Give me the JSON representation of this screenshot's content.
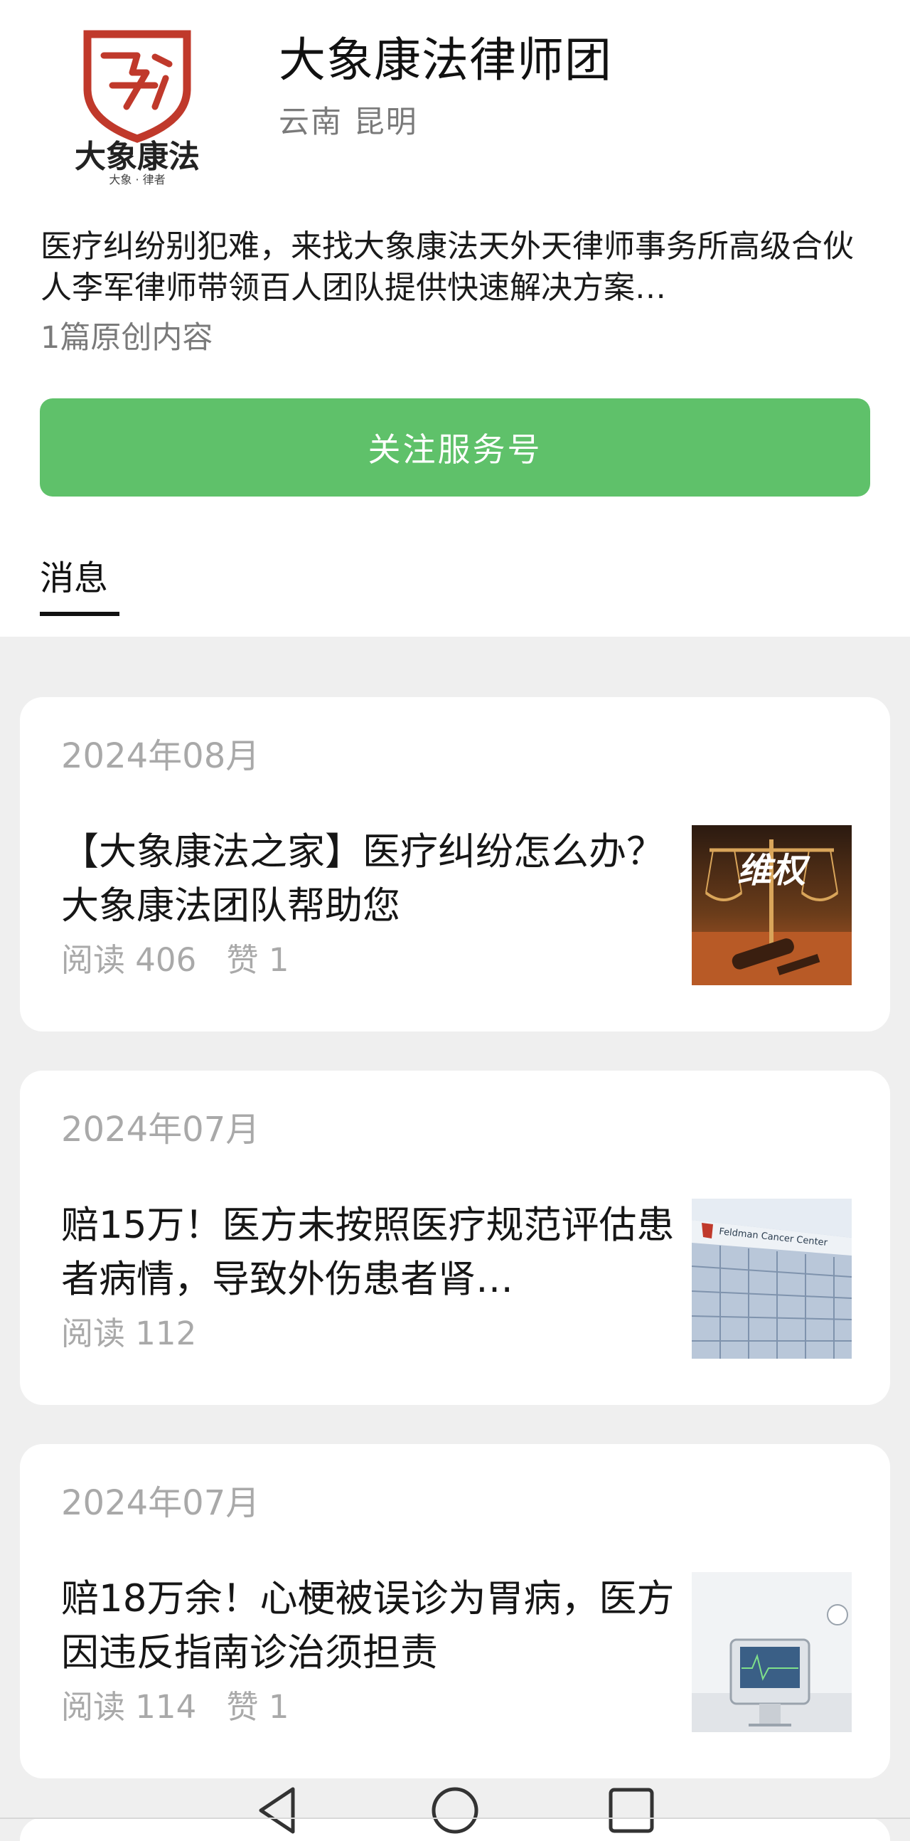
{
  "account": {
    "name": "大象康法律师团",
    "location": "云南 昆明",
    "description": "医疗纠纷别犯难，来找大象康法天外天律师事务所高级合伙人李军律师带领百人团队提供快速解决方案…",
    "stats": "1篇原创内容",
    "logo": {
      "text": "大象康法",
      "subtext": "大象 · 律者",
      "icon": "shield-emblem-icon",
      "color": "#c0392b"
    },
    "follow_label": "关注服务号"
  },
  "tabs": [
    {
      "label": "消息",
      "active": true
    }
  ],
  "articles": [
    {
      "date": "2024年08月",
      "title": "【大象康法之家】医疗纠纷怎么办？大象康法团队帮助您",
      "reads": "阅读 406",
      "likes": "赞 1",
      "thumb": {
        "caption": "维权",
        "icon": "scales-gavel-icon"
      }
    },
    {
      "date": "2024年07月",
      "title": "赔15万！医方未按照医疗规范评估患者病情，导致外伤患者肾…",
      "reads": "阅读 112",
      "likes": "",
      "thumb": {
        "caption": "Feldman Cancer Center",
        "icon": "hospital-building-icon"
      }
    },
    {
      "date": "2024年07月",
      "title": "赔18万余！心梗被误诊为胃病，医方因违反指南诊治须担责",
      "reads": "阅读 114",
      "likes": "赞 1",
      "thumb": {
        "icon": "medical-monitor-icon"
      }
    }
  ],
  "navbar": {
    "icons": [
      "back-triangle-icon",
      "home-circle-icon",
      "recents-square-icon"
    ]
  },
  "colors": {
    "accent": "#5fc16a",
    "feed_bg": "#efefef",
    "muted_text": "#a9a9a9"
  }
}
